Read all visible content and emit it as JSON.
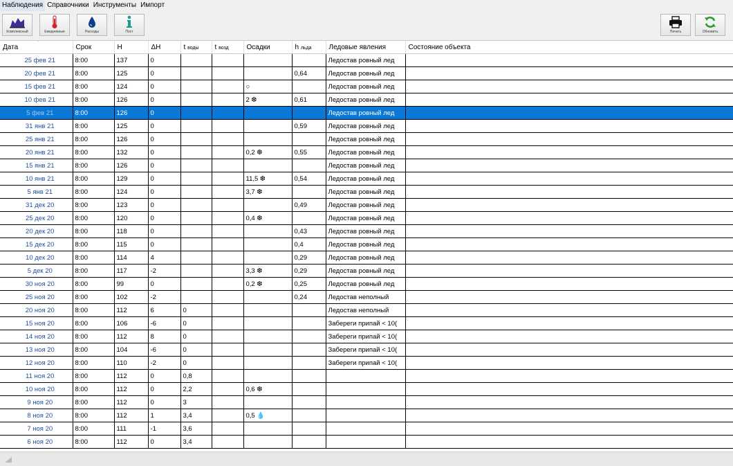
{
  "menu": [
    "Наблюдения",
    "Справочники",
    "Инструменты",
    "Импорт"
  ],
  "toolbar": {
    "left": [
      {
        "label": "Комплексный",
        "icon": "area-chart-icon"
      },
      {
        "label": "Ежедневные",
        "icon": "thermometer-icon"
      },
      {
        "label": "Расходы",
        "icon": "water-drop-icon"
      },
      {
        "label": "Пост",
        "icon": "info-icon"
      }
    ],
    "right": [
      {
        "label": "Печать",
        "icon": "printer-icon"
      },
      {
        "label": "Обновить",
        "icon": "refresh-icon"
      }
    ]
  },
  "columns": [
    "Дата",
    "Срок",
    "H",
    "ΔH",
    "t",
    "воды",
    "t",
    "возд",
    "Осадки",
    "h",
    "льда",
    "Ледовые явления",
    "Состояние объекта"
  ],
  "selected_row": 4,
  "rows": [
    {
      "date": "25 фев 21",
      "time": "8:00",
      "h": "137",
      "dh": "0",
      "tw": "",
      "ta": "",
      "precip": "",
      "ice": "",
      "phen": "Ледостав ровный лед",
      "state": ""
    },
    {
      "date": "20 фев 21",
      "time": "8:00",
      "h": "125",
      "dh": "0",
      "tw": "",
      "ta": "",
      "precip": "",
      "ice": "0,64",
      "phen": "Ледостав ровный лед",
      "state": ""
    },
    {
      "date": "15 фев 21",
      "time": "8:00",
      "h": "124",
      "dh": "0",
      "tw": "",
      "ta": "",
      "precip": "○",
      "ice": "",
      "phen": "Ледостав ровный лед",
      "state": ""
    },
    {
      "date": "10 фев 21",
      "time": "8:00",
      "h": "126",
      "dh": "0",
      "tw": "",
      "ta": "",
      "precip": "2 ❆",
      "ice": "0,61",
      "phen": "Ледостав ровный лед",
      "state": ""
    },
    {
      "date": "5 фев 21",
      "time": "8:00",
      "h": "126",
      "dh": "0",
      "tw": "",
      "ta": "",
      "precip": "",
      "ice": "",
      "phen": "Ледостав ровный лед",
      "state": ""
    },
    {
      "date": "31 янв 21",
      "time": "8:00",
      "h": "125",
      "dh": "0",
      "tw": "",
      "ta": "",
      "precip": "",
      "ice": "0,59",
      "phen": "Ледостав ровный лед",
      "state": ""
    },
    {
      "date": "25 янв 21",
      "time": "8:00",
      "h": "126",
      "dh": "0",
      "tw": "",
      "ta": "",
      "precip": "",
      "ice": "",
      "phen": "Ледостав ровный лед",
      "state": ""
    },
    {
      "date": "20 янв 21",
      "time": "8:00",
      "h": "132",
      "dh": "0",
      "tw": "",
      "ta": "",
      "precip": "0,2 ❆",
      "ice": "0,55",
      "phen": "Ледостав ровный лед",
      "state": ""
    },
    {
      "date": "15 янв 21",
      "time": "8:00",
      "h": "126",
      "dh": "0",
      "tw": "",
      "ta": "",
      "precip": "",
      "ice": "",
      "phen": "Ледостав ровный лед",
      "state": ""
    },
    {
      "date": "10 янв 21",
      "time": "8:00",
      "h": "129",
      "dh": "0",
      "tw": "",
      "ta": "",
      "precip": "11,5 ❆",
      "ice": "0,54",
      "phen": "Ледостав ровный лед",
      "state": ""
    },
    {
      "date": "5 янв 21",
      "time": "8:00",
      "h": "124",
      "dh": "0",
      "tw": "",
      "ta": "",
      "precip": "3,7 ❆",
      "ice": "",
      "phen": "Ледостав ровный лед",
      "state": ""
    },
    {
      "date": "31 дек 20",
      "time": "8:00",
      "h": "123",
      "dh": "0",
      "tw": "",
      "ta": "",
      "precip": "",
      "ice": "0,49",
      "phen": "Ледостав ровный лед",
      "state": ""
    },
    {
      "date": "25 дек 20",
      "time": "8:00",
      "h": "120",
      "dh": "0",
      "tw": "",
      "ta": "",
      "precip": "0,4 ❆",
      "ice": "",
      "phen": "Ледостав ровный лед",
      "state": ""
    },
    {
      "date": "20 дек 20",
      "time": "8:00",
      "h": "118",
      "dh": "0",
      "tw": "",
      "ta": "",
      "precip": "",
      "ice": "0,43",
      "phen": "Ледостав ровный лед",
      "state": ""
    },
    {
      "date": "15 дек 20",
      "time": "8:00",
      "h": "115",
      "dh": "0",
      "tw": "",
      "ta": "",
      "precip": "",
      "ice": "0,4",
      "phen": "Ледостав ровный лед",
      "state": ""
    },
    {
      "date": "10 дек 20",
      "time": "8:00",
      "h": "114",
      "dh": "4",
      "tw": "",
      "ta": "",
      "precip": "",
      "ice": "0,29",
      "phen": "Ледостав ровный лед",
      "state": ""
    },
    {
      "date": "5 дек 20",
      "time": "8:00",
      "h": "117",
      "dh": "-2",
      "tw": "",
      "ta": "",
      "precip": "3,3 ❆",
      "ice": "0,29",
      "phen": "Ледостав ровный лед",
      "state": ""
    },
    {
      "date": "30 ноя 20",
      "time": "8:00",
      "h": "99",
      "dh": "0",
      "tw": "",
      "ta": "",
      "precip": "0,2 ❆",
      "ice": "0,25",
      "phen": "Ледостав ровный лед",
      "state": ""
    },
    {
      "date": "25 ноя 20",
      "time": "8:00",
      "h": "102",
      "dh": "-2",
      "tw": "",
      "ta": "",
      "precip": "",
      "ice": "0,24",
      "phen": "Ледостав неполный",
      "state": ""
    },
    {
      "date": "20 ноя 20",
      "time": "8:00",
      "h": "112",
      "dh": "6",
      "tw": "0",
      "ta": "",
      "precip": "",
      "ice": "",
      "phen": "Ледостав неполный",
      "state": ""
    },
    {
      "date": "15 ноя 20",
      "time": "8:00",
      "h": "106",
      "dh": "-6",
      "tw": "0",
      "ta": "",
      "precip": "",
      "ice": "",
      "phen": "Забереги  припай < 10(",
      "state": ""
    },
    {
      "date": "14 ноя 20",
      "time": "8:00",
      "h": "112",
      "dh": "8",
      "tw": "0",
      "ta": "",
      "precip": "",
      "ice": "",
      "phen": "Забереги  припай < 10(",
      "state": ""
    },
    {
      "date": "13 ноя 20",
      "time": "8:00",
      "h": "104",
      "dh": "-6",
      "tw": "0",
      "ta": "",
      "precip": "",
      "ice": "",
      "phen": "Забереги  припай < 10(",
      "state": ""
    },
    {
      "date": "12 ноя 20",
      "time": "8:00",
      "h": "110",
      "dh": "-2",
      "tw": "0",
      "ta": "",
      "precip": "",
      "ice": "",
      "phen": "Забереги  припай < 10(",
      "state": ""
    },
    {
      "date": "11 ноя 20",
      "time": "8:00",
      "h": "112",
      "dh": "0",
      "tw": "0,8",
      "ta": "",
      "precip": "",
      "ice": "",
      "phen": "",
      "state": ""
    },
    {
      "date": "10 ноя 20",
      "time": "8:00",
      "h": "112",
      "dh": "0",
      "tw": "2,2",
      "ta": "",
      "precip": "0,6 ❆",
      "ice": "",
      "phen": "",
      "state": ""
    },
    {
      "date": "9 ноя 20",
      "time": "8:00",
      "h": "112",
      "dh": "0",
      "tw": "3",
      "ta": "",
      "precip": "",
      "ice": "",
      "phen": "",
      "state": ""
    },
    {
      "date": "8 ноя 20",
      "time": "8:00",
      "h": "112",
      "dh": "1",
      "tw": "3,4",
      "ta": "",
      "precip": "0,5 💧",
      "ice": "",
      "phen": "",
      "state": ""
    },
    {
      "date": "7 ноя 20",
      "time": "8:00",
      "h": "111",
      "dh": "-1",
      "tw": "3,6",
      "ta": "",
      "precip": "",
      "ice": "",
      "phen": "",
      "state": ""
    },
    {
      "date": "6 ноя 20",
      "time": "8:00",
      "h": "112",
      "dh": "0",
      "tw": "3,4",
      "ta": "",
      "precip": "",
      "ice": "",
      "phen": "",
      "state": ""
    }
  ]
}
